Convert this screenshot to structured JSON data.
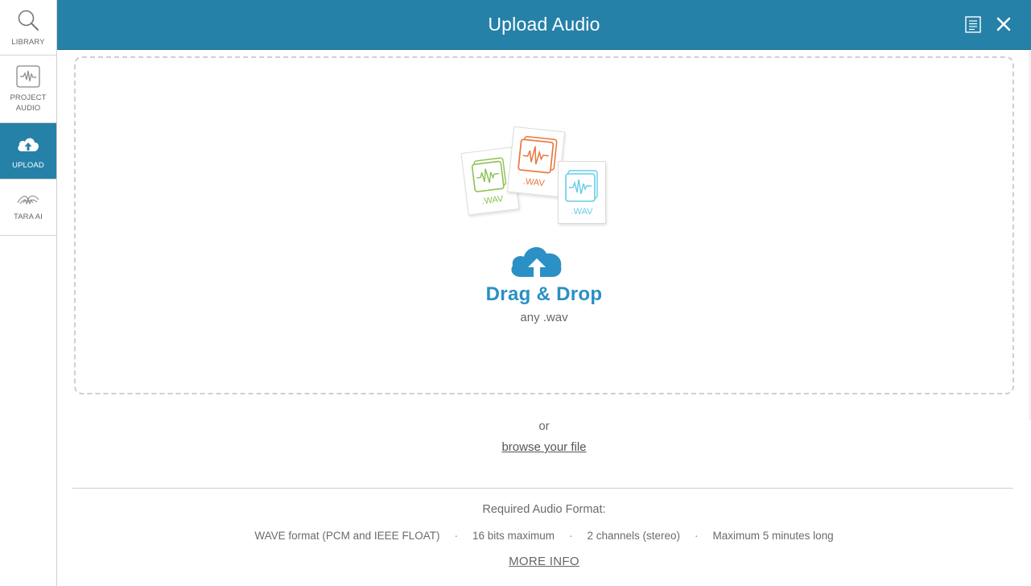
{
  "sidebar": {
    "items": [
      {
        "label": "LIBRARY",
        "icon": "search-icon"
      },
      {
        "label": "PROJECT AUDIO",
        "icon": "waveform-icon"
      },
      {
        "label": "UPLOAD",
        "icon": "cloud-upload-icon",
        "active": true
      },
      {
        "label": "TARA AI",
        "icon": "tara-ai-icon"
      }
    ]
  },
  "header": {
    "title": "Upload Audio",
    "notes_icon": "notes-icon",
    "close_icon": "close-icon"
  },
  "dropzone": {
    "files": [
      ".WAV",
      ".WAV",
      ".WAV"
    ],
    "title": "Drag & Drop",
    "subtitle": "any .wav"
  },
  "or_text": "or",
  "browse_link": "browse your file",
  "requirements": {
    "title": "Required Audio Format:",
    "items": [
      "WAVE format (PCM and IEEE FLOAT)",
      "16 bits maximum",
      "2 channels (stereo)",
      "Maximum 5 minutes long"
    ],
    "separator": "·",
    "more_info": "MORE INFO"
  },
  "colors": {
    "accent": "#2581a8",
    "drag_title": "#2a90c6",
    "green": "#8cc152",
    "orange": "#e9773f",
    "light_blue": "#66cde6"
  }
}
